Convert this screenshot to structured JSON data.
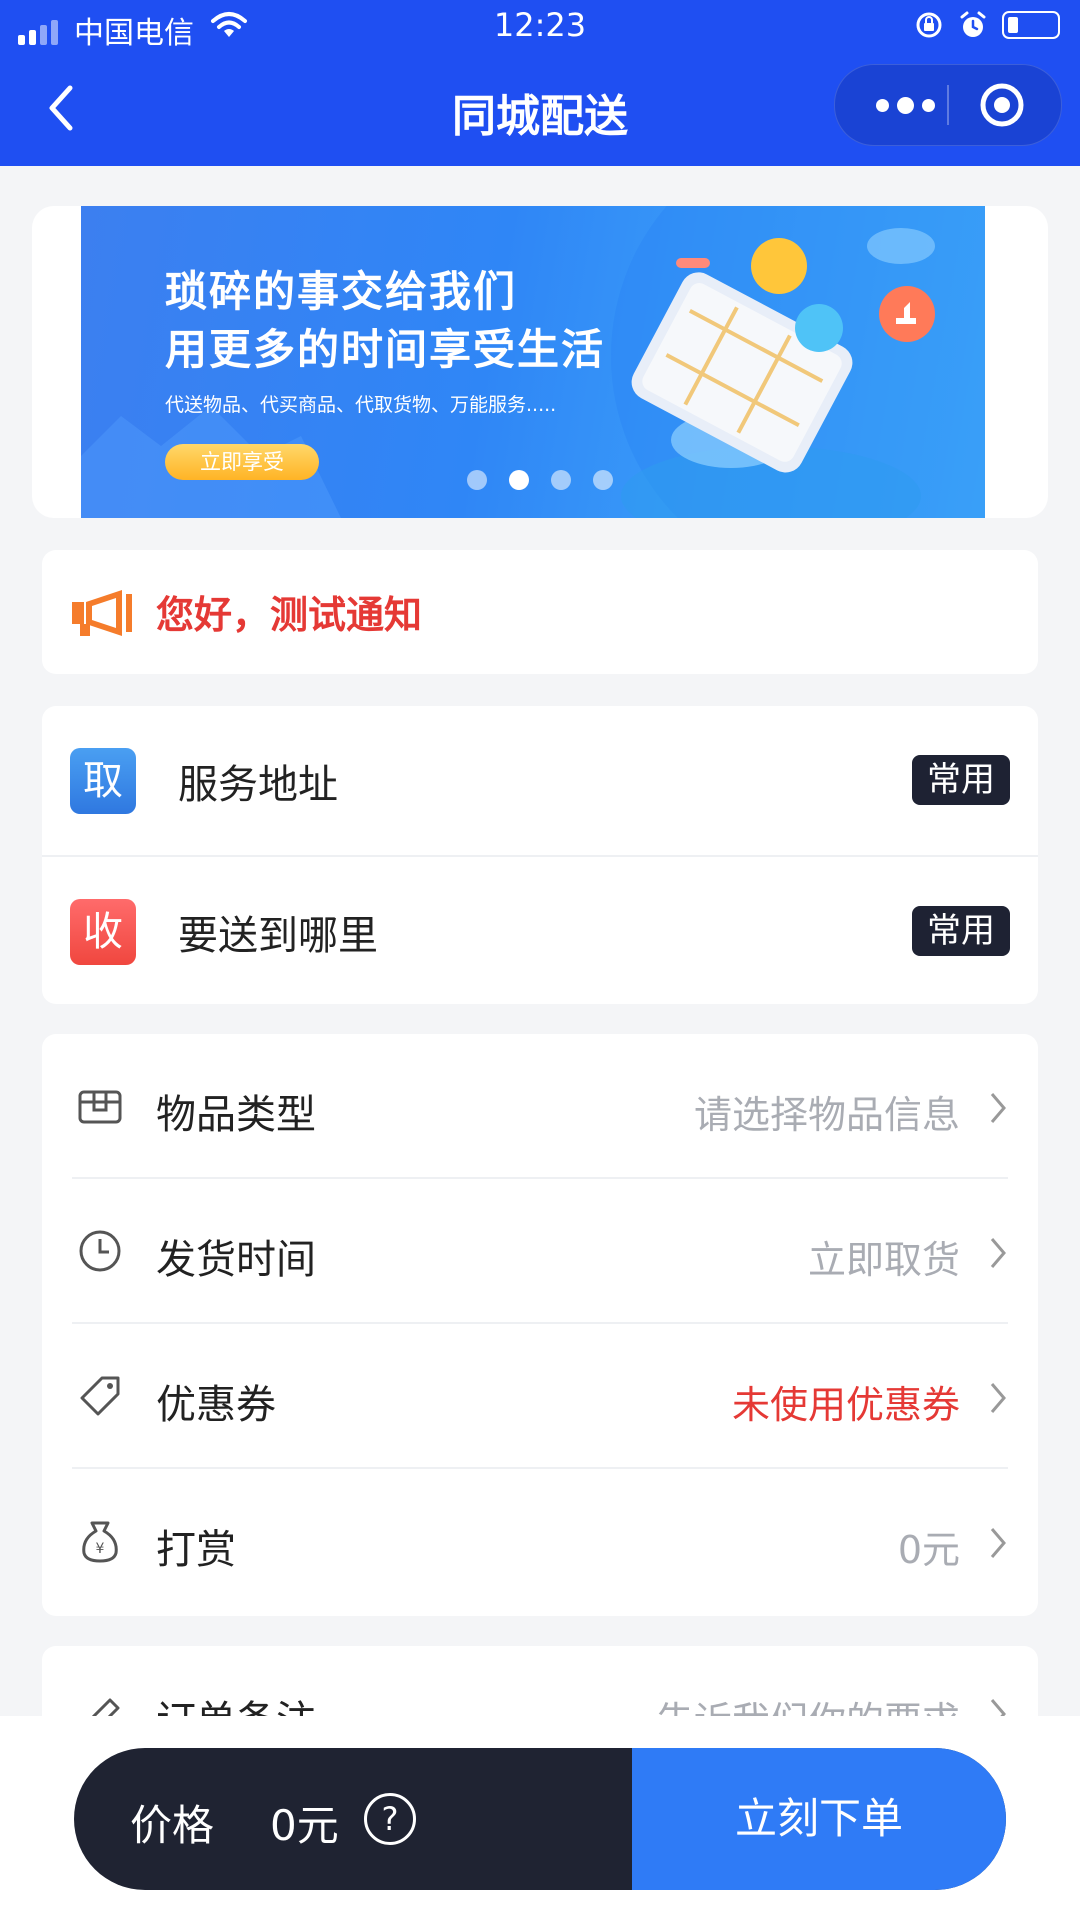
{
  "statusbar": {
    "carrier": "中国电信",
    "time": "12:23"
  },
  "navbar": {
    "title": "同城配送"
  },
  "banner": {
    "line1": "琐碎的事交给我们",
    "line2": "用更多的时间享受生活",
    "subtitle": "代送物品、代买商品、代取货物、万能服务.....",
    "cta": "立即享受",
    "active_page": 2,
    "page_count": 4
  },
  "notice": {
    "text": "您好，测试通知"
  },
  "address": {
    "pickup": {
      "badge": "取",
      "label": "服务地址",
      "tag": "常用"
    },
    "deliver": {
      "badge": "收",
      "label": "要送到哪里",
      "tag": "常用"
    }
  },
  "options": [
    {
      "icon": "box-icon",
      "label": "物品类型",
      "value": "请选择物品信息",
      "value_color": "gray"
    },
    {
      "icon": "clock-icon",
      "label": "发货时间",
      "value": "立即取货",
      "value_color": "gray"
    },
    {
      "icon": "tag-icon",
      "label": "优惠券",
      "value": "未使用优惠券",
      "value_color": "red"
    },
    {
      "icon": "money-bag-icon",
      "label": "打赏",
      "value": "0元",
      "value_color": "gray"
    }
  ],
  "remark": {
    "label": "订单备注",
    "value": "告诉我们你的要求"
  },
  "footer": {
    "price_label": "价格",
    "price_value": "0元",
    "help": "?",
    "order_button": "立刻下单"
  },
  "colors": {
    "brand_blue": "#1f4ff2",
    "button_blue": "#2f7bf6",
    "dark": "#1f2332",
    "red": "#e53935",
    "orange": "#f57c2b"
  }
}
